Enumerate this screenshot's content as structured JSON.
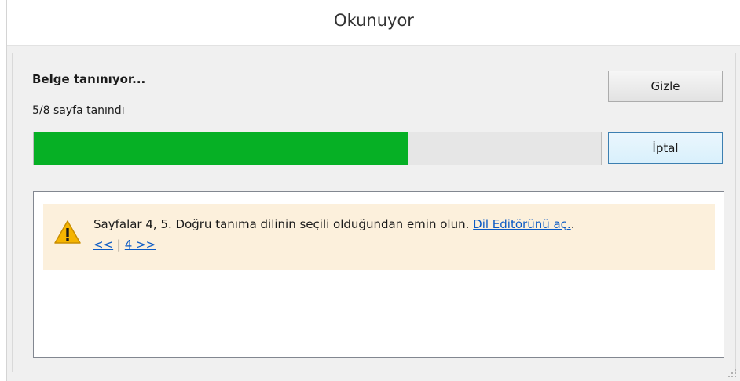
{
  "window": {
    "title": "Okunuyor"
  },
  "status": {
    "heading": "Belge tanınıyor...",
    "pages_text": "5/8 sayfa tanındı",
    "pages_done": 5,
    "pages_total": 8
  },
  "progress": {
    "fraction": 0.66,
    "fill_color": "#06b025"
  },
  "buttons": {
    "hide_label": "Gizle",
    "cancel_label": "İptal"
  },
  "message": {
    "icon": "warning-icon",
    "text": "Sayfalar 4, 5. Doğru tanıma dilinin seçili olduğundan emin olun.",
    "link_label": "Dil Editörünü aç.",
    "trailing": ".",
    "prev_label": "<<",
    "separator": "|",
    "next_label": "4 >>"
  }
}
